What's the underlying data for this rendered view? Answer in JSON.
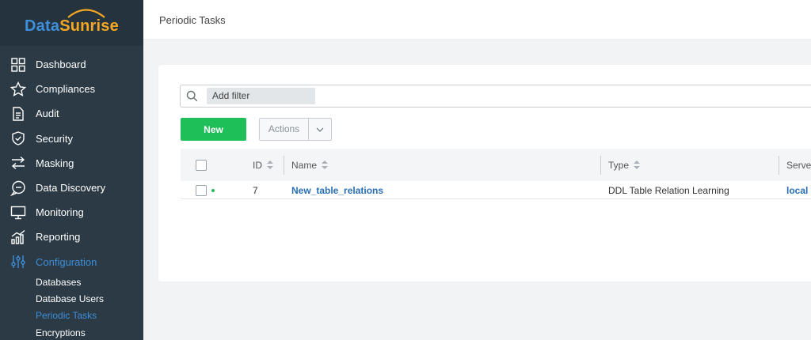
{
  "logo": {
    "part1": "Data",
    "part2": "Sunrise"
  },
  "colors": {
    "sidebar": "#2b3a45",
    "accent": "#3d8fd9",
    "brand_orange": "#f5a623",
    "new_button": "#1ebf59"
  },
  "sidebar": {
    "items": [
      {
        "label": "Dashboard",
        "icon": "grid-icon"
      },
      {
        "label": "Compliances",
        "icon": "star-icon"
      },
      {
        "label": "Audit",
        "icon": "document-icon"
      },
      {
        "label": "Security",
        "icon": "shield-icon"
      },
      {
        "label": "Masking",
        "icon": "swap-arrows-icon"
      },
      {
        "label": "Data Discovery",
        "icon": "chat-bubble-icon"
      },
      {
        "label": "Monitoring",
        "icon": "monitor-icon"
      },
      {
        "label": "Reporting",
        "icon": "bar-chart-icon"
      },
      {
        "label": "Configuration",
        "icon": "sliders-icon",
        "active": true
      }
    ],
    "subitems": [
      {
        "label": "Databases"
      },
      {
        "label": "Database Users"
      },
      {
        "label": "Periodic Tasks",
        "active": true
      },
      {
        "label": "Encryptions"
      }
    ]
  },
  "header": {
    "title": "Periodic Tasks"
  },
  "filter": {
    "label": "Add filter"
  },
  "toolbar": {
    "new_label": "New",
    "actions_label": "Actions"
  },
  "table": {
    "columns": [
      "ID",
      "Name",
      "Type",
      "Server"
    ],
    "rows": [
      {
        "id": "7",
        "name": "New_table_relations",
        "type": "DDL Table Relation Learning",
        "server": "local",
        "status": "active"
      }
    ]
  }
}
